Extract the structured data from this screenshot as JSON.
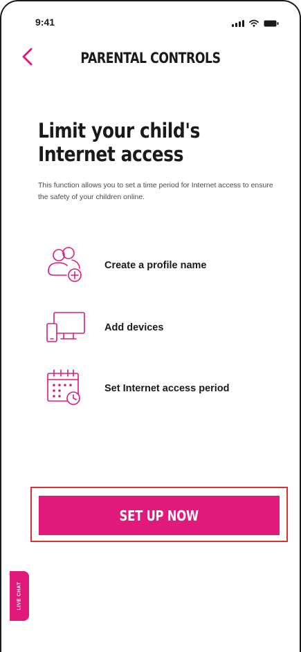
{
  "status_bar": {
    "time": "9:41",
    "signal_icon": "signal-icon",
    "wifi_icon": "wifi-icon",
    "battery_icon": "battery-icon"
  },
  "header": {
    "back_icon": "chevron-left-icon",
    "title": "PARENTAL CONTROLS"
  },
  "intro": {
    "headline": "Limit your child's Internet access",
    "description": "This function allows you to set a time period for Internet access to ensure the safety of your children online."
  },
  "features": [
    {
      "icon": "profile-add-icon",
      "label": "Create a profile name"
    },
    {
      "icon": "devices-icon",
      "label": "Add devices"
    },
    {
      "icon": "calendar-clock-icon",
      "label": "Set Internet access period"
    }
  ],
  "cta": {
    "label": "SET UP NOW"
  },
  "live_chat": {
    "label": "LIVE CHAT"
  },
  "colors": {
    "accent": "#e0197a",
    "highlight_border": "#d9322b",
    "text_primary": "#1a1a1a",
    "text_secondary": "#4a4a4a"
  }
}
